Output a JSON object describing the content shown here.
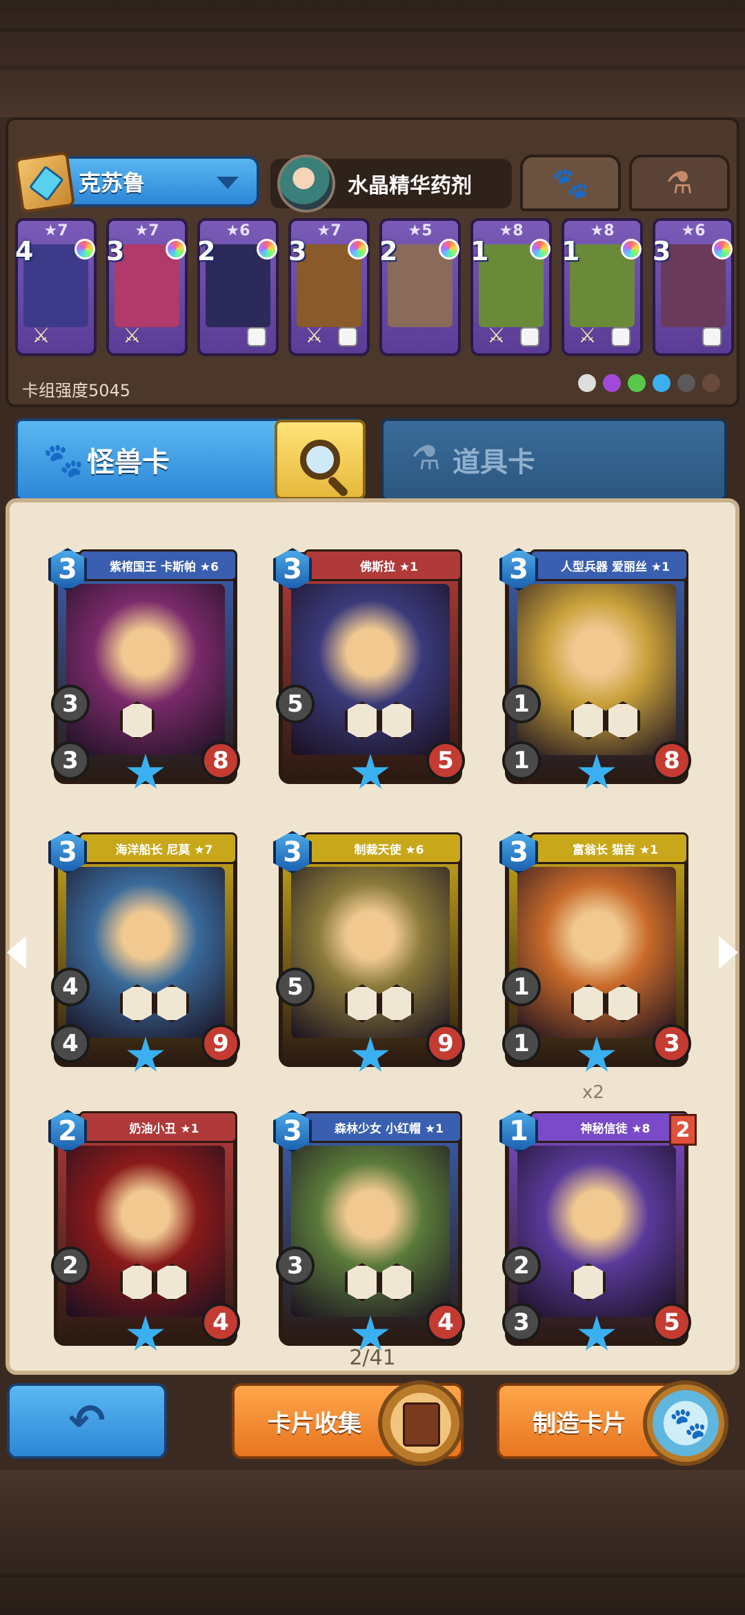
{
  "deck": {
    "name": "克苏鲁",
    "hero_name": "水晶精华药剂",
    "strength_label": "卡组强度5045",
    "cards": [
      {
        "cost": "4",
        "stars": "★7",
        "art": "#3d3a8a"
      },
      {
        "cost": "3",
        "stars": "★7",
        "art": "#b03a6a"
      },
      {
        "cost": "2",
        "stars": "★6",
        "art": "#2c2a5a"
      },
      {
        "cost": "3",
        "stars": "★7",
        "art": "#8a5a2a"
      },
      {
        "cost": "2",
        "stars": "★5",
        "art": "#8a6a5a"
      },
      {
        "cost": "1",
        "stars": "★8",
        "art": "#6a8a3a"
      },
      {
        "cost": "1",
        "stars": "★8",
        "art": "#6a8a3a"
      },
      {
        "cost": "3",
        "stars": "★6",
        "art": "#6a3a5a"
      }
    ]
  },
  "tabs": {
    "monster": "怪兽卡",
    "item": "道具卡"
  },
  "cards": [
    {
      "cost": "3",
      "title": "紫棺国王 卡斯帕 ★6",
      "atk": "3",
      "def": "3",
      "hp": "8",
      "s1": "1",
      "s2": "",
      "frame": "#3a5fb0",
      "art": "#7a2a6a"
    },
    {
      "cost": "3",
      "title": "佛斯拉 ★1",
      "atk": "5",
      "def": "",
      "hp": "5",
      "s1": "2",
      "s2": "1",
      "frame": "#b03a3a",
      "art": "#3a3a7a"
    },
    {
      "cost": "3",
      "title": "人型兵器 爱丽丝 ★1",
      "atk": "1",
      "def": "1",
      "hp": "8",
      "s1": "2",
      "s2": "2",
      "frame": "#3a5fb0",
      "art": "#c8a03a"
    },
    {
      "cost": "3",
      "title": "海洋船长 尼莫 ★7",
      "atk": "4",
      "def": "4",
      "hp": "9",
      "s1": "",
      "s2": "4",
      "frame": "#c8a81a",
      "art": "#3a6a9a"
    },
    {
      "cost": "3",
      "title": "制裁天使 ★6",
      "atk": "5",
      "def": "",
      "hp": "9",
      "s1": "5",
      "s2": "5",
      "frame": "#c8a81a",
      "art": "#8a7a3a"
    },
    {
      "cost": "3",
      "title": "富翁长 猫吉 ★1",
      "atk": "1",
      "def": "1",
      "hp": "3",
      "s1": "3",
      "s2": "3",
      "frame": "#c8a81a",
      "art": "#c86a2a"
    },
    {
      "cost": "2",
      "title": "奶油小丑 ★1",
      "atk": "2",
      "def": "",
      "hp": "4",
      "s1": "1",
      "s2": "1",
      "frame": "#b03a3a",
      "art": "#8a1a1a"
    },
    {
      "cost": "3",
      "title": "森林少女 小红帽 ★1",
      "atk": "3",
      "def": "",
      "hp": "4",
      "s1": "3",
      "s2": "1",
      "frame": "#3a5fb0",
      "art": "#5a7a3a"
    },
    {
      "cost": "1",
      "title": "神秘信徒 ★8",
      "atk": "2",
      "def": "3",
      "hp": "5",
      "s1": "",
      "s2": "",
      "frame": "#7a4ac8",
      "art": "#5a3a9a",
      "badge": "2",
      "dup": "x2"
    }
  ],
  "page_counter": "2/41",
  "buttons": {
    "collect": "卡片收集",
    "craft": "制造卡片"
  },
  "colors": {
    "blue_accent": "#2d86d6",
    "orange_accent": "#e77520",
    "parchment": "#efe4cf"
  }
}
